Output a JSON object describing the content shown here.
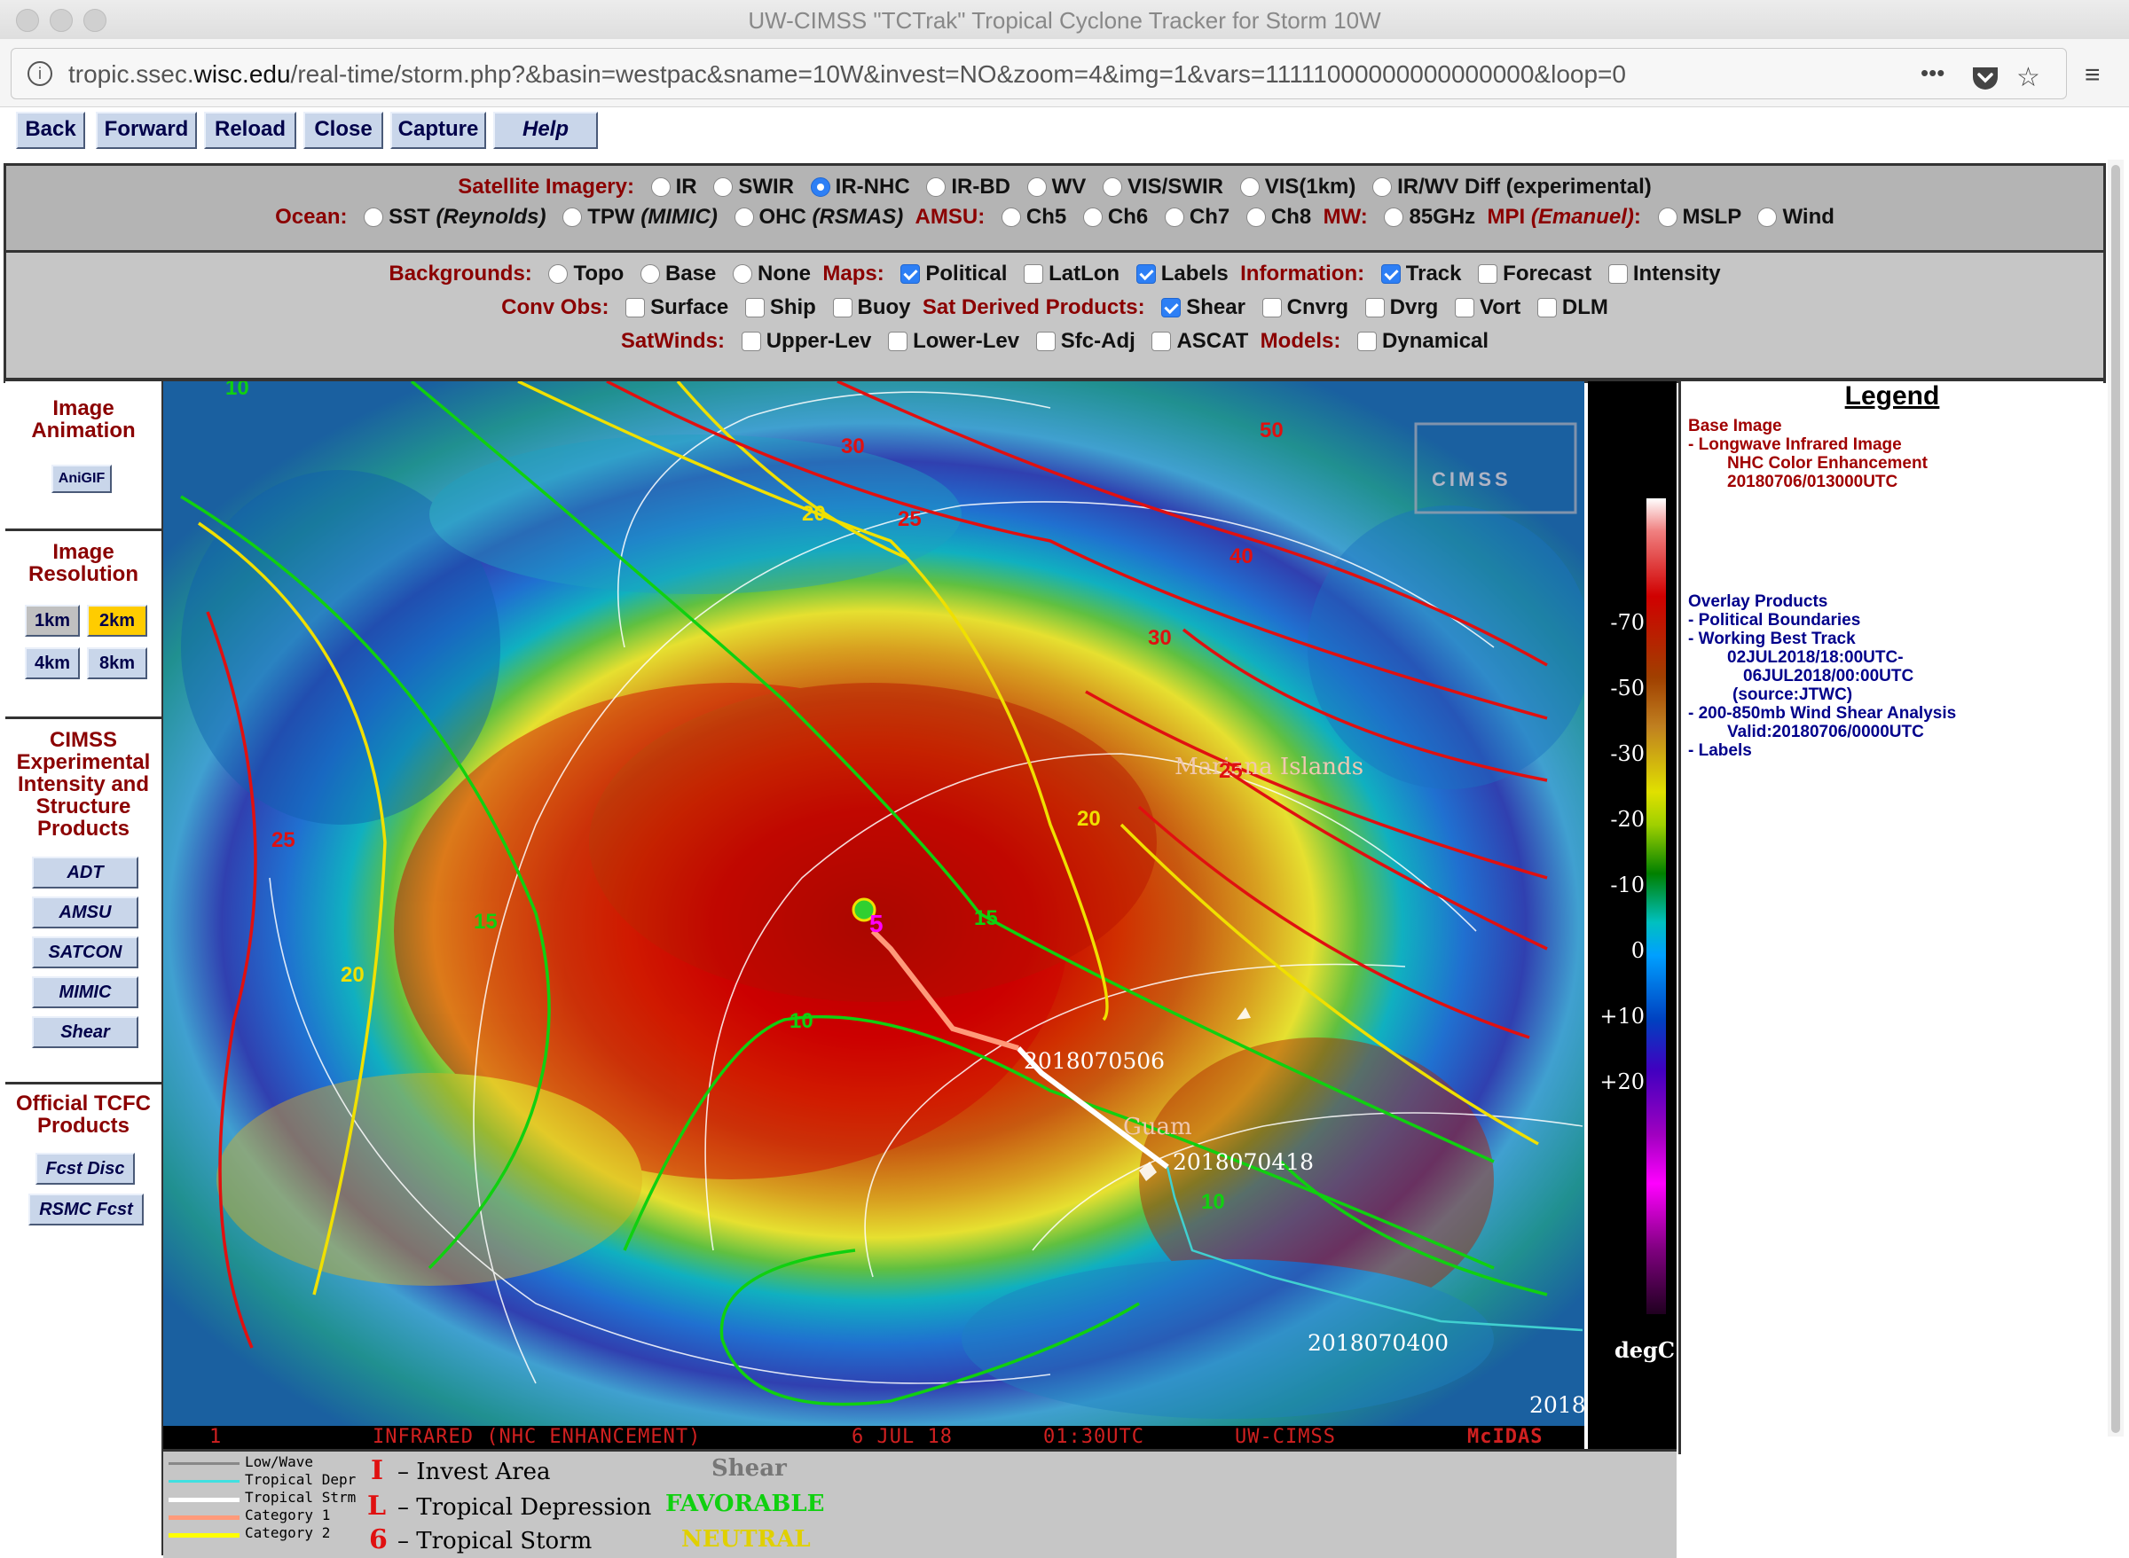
{
  "window": {
    "title": "UW-CIMSS \"TCTrak\" Tropical Cyclone Tracker for Storm 10W",
    "url_prefix": "tropic.ssec.",
    "url_domain": "wisc.edu",
    "url_rest": "/real-time/storm.php?&basin=westpac&sname=10W&invest=NO&zoom=4&img=1&vars=11111000000000000000&loop=0",
    "menu_icon": "•••"
  },
  "toolbar": {
    "back": "Back",
    "forward": "Forward",
    "reload": "Reload",
    "close": "Close",
    "capture": "Capture",
    "help": "Help"
  },
  "sat": {
    "label": "Satellite Imagery:",
    "options": [
      "IR",
      "SWIR",
      "IR-NHC",
      "IR-BD",
      "WV",
      "VIS/SWIR",
      "VIS(1km)",
      "IR/WV Diff (experimental)"
    ]
  },
  "ocean": {
    "label": "Ocean:",
    "sst": "SST",
    "sst_src": "(Reynolds)",
    "tpw": "TPW",
    "tpw_src": "(MIMIC)",
    "ohc": "OHC",
    "ohc_src": "(RSMAS)",
    "amsu_label": "AMSU:",
    "amsu": [
      "Ch5",
      "Ch6",
      "Ch7",
      "Ch8"
    ],
    "mw_label": "MW:",
    "mw": "85GHz",
    "mpi_label": "MPI",
    "mpi_src": "(Emanuel)",
    "mpi_colon": ":",
    "mpi": [
      "MSLP",
      "Wind"
    ]
  },
  "overlay": {
    "bg_label": "Backgrounds:",
    "bg": [
      "Topo",
      "Base",
      "None"
    ],
    "maps_label": "Maps:",
    "maps": [
      "Political",
      "LatLon",
      "Labels"
    ],
    "info_label": "Information:",
    "info": [
      "Track",
      "Forecast",
      "Intensity"
    ],
    "conv_label": "Conv Obs:",
    "conv": [
      "Surface",
      "Ship",
      "Buoy"
    ],
    "sdp_label": "Sat Derived Products:",
    "sdp": [
      "Shear",
      "Cnvrg",
      "Dvrg",
      "Vort",
      "DLM"
    ],
    "winds_label": "SatWinds:",
    "winds": [
      "Upper-Lev",
      "Lower-Lev",
      "Sfc-Adj",
      "ASCAT"
    ],
    "models_label": "Models:",
    "models": [
      "Dynamical"
    ]
  },
  "sidebar": {
    "anim_h1": "Image",
    "anim_h2": "Animation",
    "anigif": "AniGIF",
    "res_h1": "Image",
    "res_h2": "Resolution",
    "res": [
      "1km",
      "2km",
      "4km",
      "8km"
    ],
    "cimss_h": [
      "CIMSS",
      "Experimental",
      "Intensity and",
      "Structure",
      "Products"
    ],
    "products": [
      "ADT",
      "AMSU",
      "SATCON",
      "MIMIC",
      "Shear"
    ],
    "tcfc_h1": "Official TCFC",
    "tcfc_h2": "Products",
    "tcfc": [
      "Fcst Disc",
      "RSMC Fcst"
    ]
  },
  "map": {
    "labels": {
      "mariana": "Mariana Islands",
      "guam": "Guam",
      "t1": "2018070506",
      "t2": "2018070418",
      "t3": "2018070400",
      "t4": "2018",
      "storm": "5",
      "cimss": "CIMSS",
      "c10a": "10",
      "c10b": "10",
      "c10c": "10",
      "c15": "15",
      "c15b": "15",
      "y20a": "20",
      "y20b": "20",
      "y20c": "20",
      "r25a": "25",
      "r25b": "25",
      "r30a": "30",
      "r30b": "30",
      "r40": "40",
      "r50": "50",
      "r25c": "25"
    },
    "status": {
      "n": "1",
      "text": "INFRARED (NHC ENHANCEMENT)",
      "date": "6 JUL 18",
      "time": "01:30UTC",
      "org": "UW-CIMSS",
      "sw": "McIDAS"
    }
  },
  "colorbar": {
    "ticks": [
      "-70",
      "-50",
      "-30",
      "-20",
      "-10",
      "0",
      "+10",
      "+20"
    ],
    "unit": "degC"
  },
  "legend": {
    "title": "Legend",
    "base_h": "Base Image",
    "base": [
      "-  Longwave Infrared Image",
      "NHC Color Enhancement",
      "20180706/013000UTC"
    ],
    "over_h": "Overlay Products",
    "over": [
      "-  Political Boundaries",
      "-  Working Best Track",
      "02JUL2018/18:00UTC-",
      "06JUL2018/00:00UTC",
      "(source:JTWC)",
      "-  200-850mb Wind Shear Analysis",
      "Valid:20180706/0000UTC",
      "-  Labels"
    ]
  },
  "key": {
    "lines": [
      "Low/Wave",
      "Tropical Depr",
      "Tropical Strm",
      "Category 1",
      "Category 2"
    ],
    "line_colors": [
      "#888888",
      "#40e0e0",
      "#ffffff",
      "#ff9a7a",
      "#ffff00"
    ],
    "sym_i": "I",
    "sym_l": "L",
    "sym_6": "6",
    "invest": "– Invest Area",
    "depr": "– Tropical Depression",
    "storm": "– Tropical Storm",
    "shear": "Shear",
    "favorable": "FAVORABLE",
    "neutral": "NEUTRAL"
  }
}
